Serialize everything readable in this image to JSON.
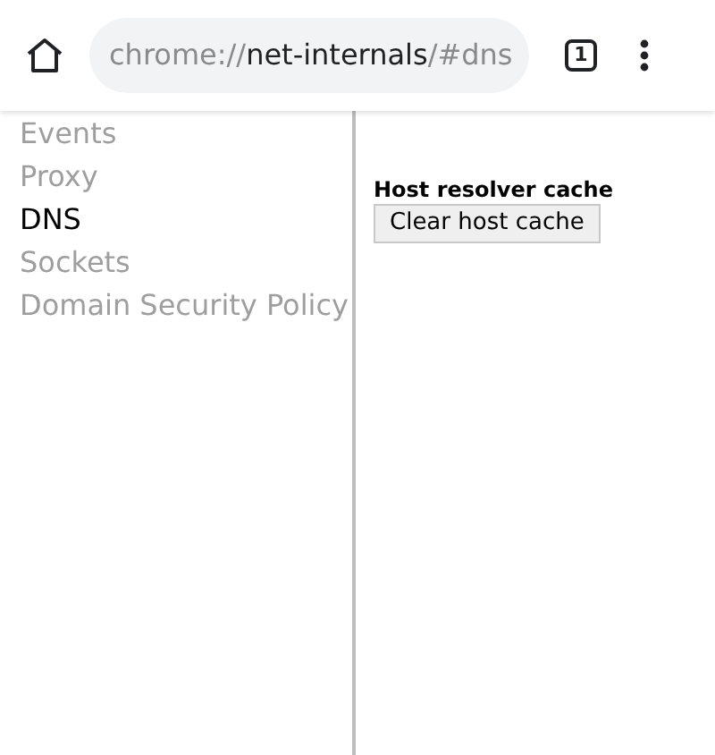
{
  "toolbar": {
    "url": {
      "scheme": "chrome://",
      "host": "net-internals",
      "rest": "/#dns"
    },
    "tab_count": "1"
  },
  "sidebar": {
    "items": [
      {
        "label": "Events",
        "selected": false
      },
      {
        "label": "Proxy",
        "selected": false
      },
      {
        "label": "DNS",
        "selected": true
      },
      {
        "label": "Sockets",
        "selected": false
      },
      {
        "label": "Domain Security Policy",
        "selected": false
      }
    ]
  },
  "content": {
    "heading": "Host resolver cache",
    "button": "Clear host cache"
  }
}
